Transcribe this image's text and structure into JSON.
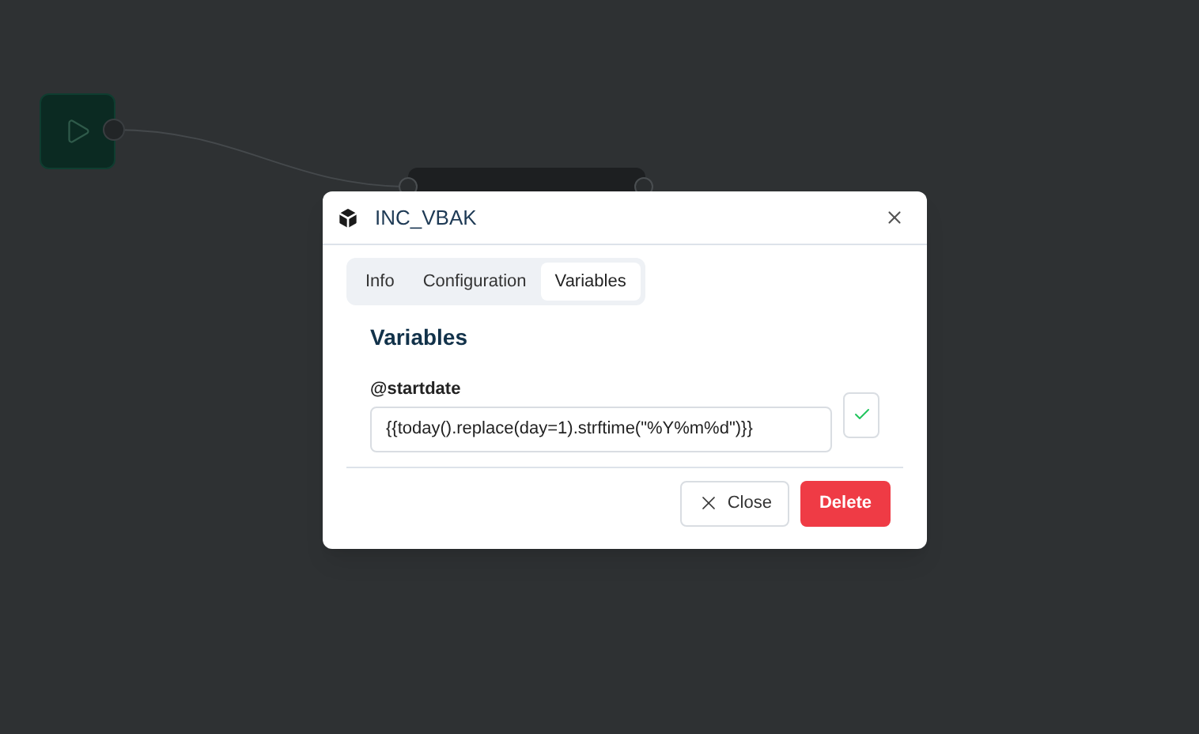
{
  "dialog": {
    "title": "INC_VBAK",
    "tabs": [
      {
        "label": "Info",
        "selected": false
      },
      {
        "label": "Configuration",
        "selected": false
      },
      {
        "label": "Variables",
        "selected": true
      }
    ],
    "section_title": "Variables",
    "variables": [
      {
        "label": "@startdate",
        "value": "{{today().replace(day=1).strftime(\"%Y%m%d\")}}"
      }
    ],
    "buttons": [
      {
        "label": "Close",
        "kind": "secondary"
      },
      {
        "label": "Delete",
        "kind": "danger"
      }
    ]
  }
}
